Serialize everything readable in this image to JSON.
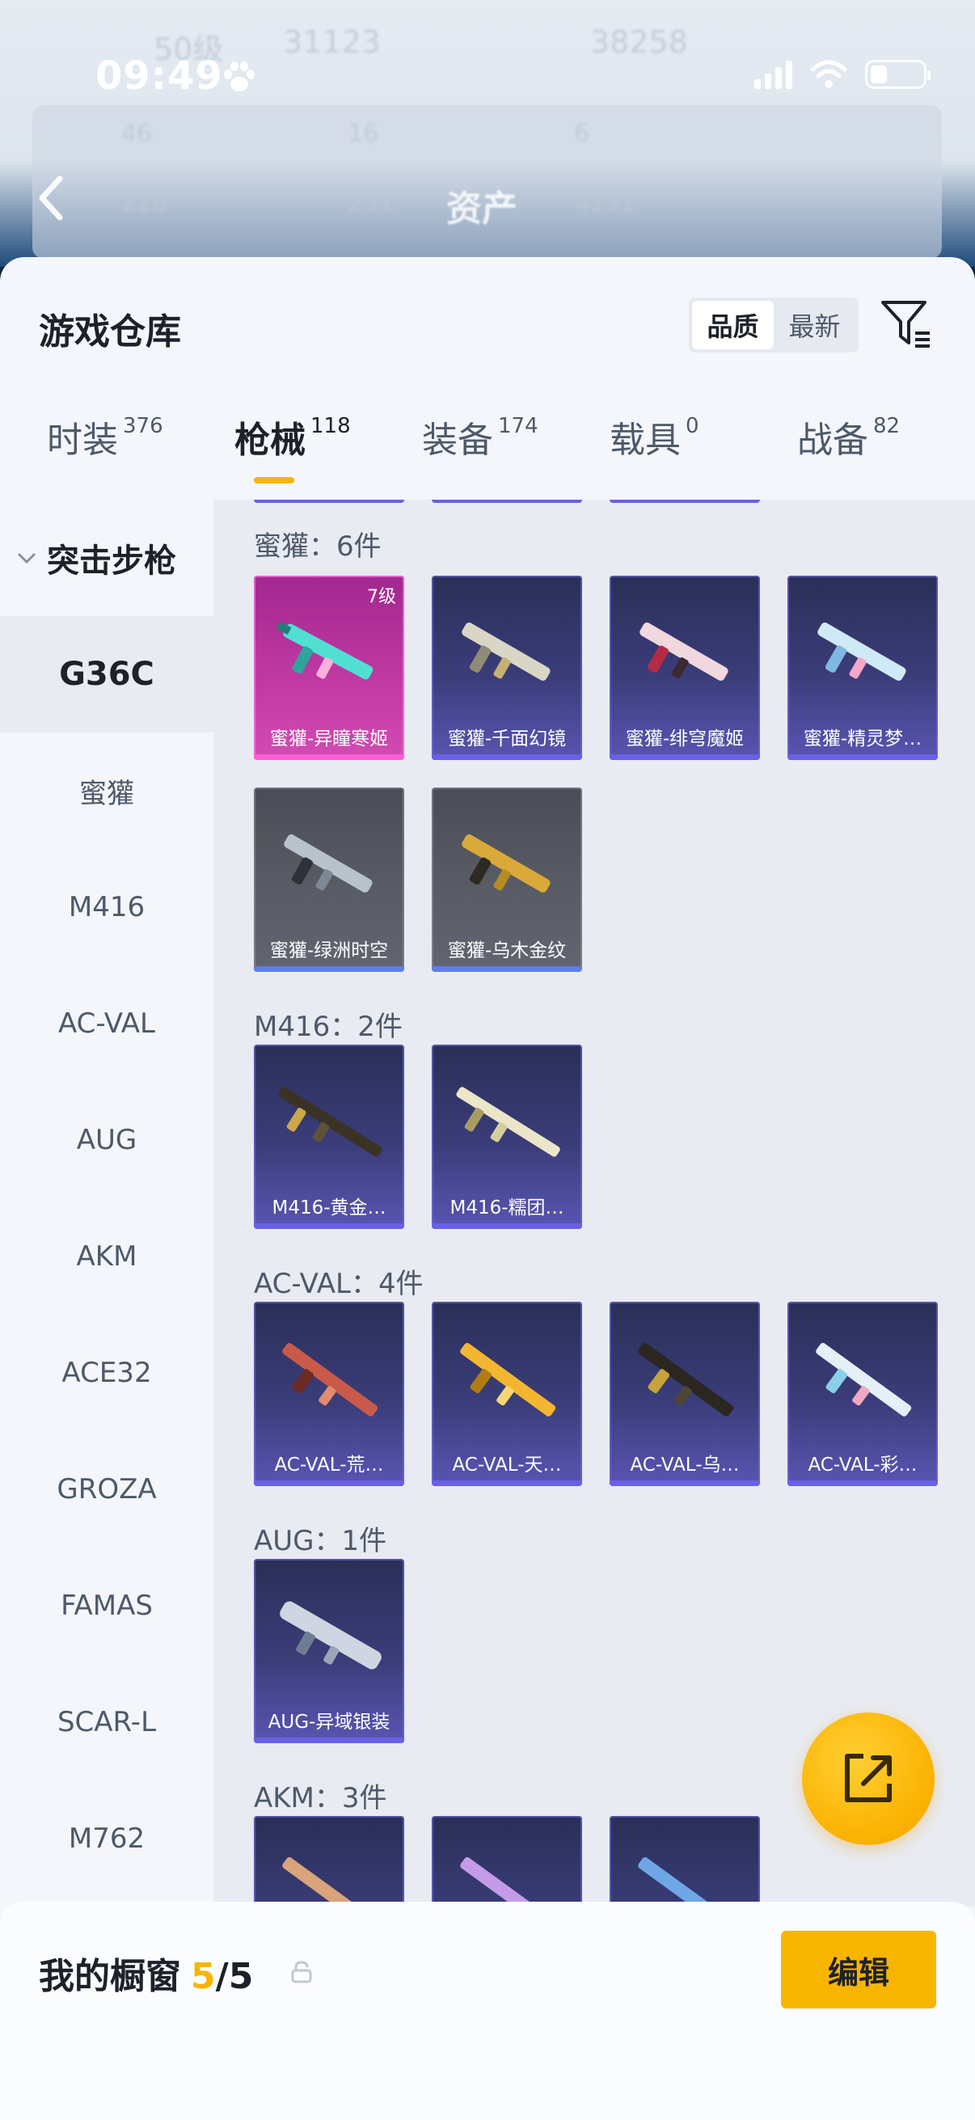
{
  "status_bar": {
    "time": "09:49"
  },
  "background": {
    "ghost_level": "50级",
    "ghost_count_a": "31123",
    "ghost_count_b": "38258",
    "ghost_stats_row1": [
      "46",
      "16",
      "6"
    ],
    "ghost_stats_row2": [
      "228",
      "231",
      "4131"
    ],
    "title": "资产"
  },
  "sheet": {
    "title": "游戏仓库",
    "sort_options": [
      "品质",
      "最新"
    ],
    "sort_selected": "品质"
  },
  "tabs": [
    {
      "label": "时装",
      "count": "376"
    },
    {
      "label": "枪械",
      "count": "118"
    },
    {
      "label": "装备",
      "count": "174"
    },
    {
      "label": "载具",
      "count": "0"
    },
    {
      "label": "战备",
      "count": "82"
    }
  ],
  "active_tab": "枪械",
  "sidebar": {
    "group": "突击步枪",
    "items": [
      "G36C",
      "蜜獾",
      "M416",
      "AC-VAL",
      "AUG",
      "AKM",
      "ACE32",
      "GROZA",
      "FAMAS",
      "SCAR-L",
      "M762"
    ],
    "active": "G36C"
  },
  "sections": [
    {
      "title": "蜜獾：6件",
      "items": [
        {
          "label": "蜜獾-异瞳寒姬",
          "level": "7级",
          "style": "pink"
        },
        {
          "label": "蜜獾-千面幻镜",
          "style": "purple"
        },
        {
          "label": "蜜獾-绯穹魔姬",
          "style": "purple"
        },
        {
          "label": "蜜獾-精灵梦…",
          "style": "purple"
        },
        {
          "label": "蜜獾-绿洲时空",
          "style": "gray"
        },
        {
          "label": "蜜獾-乌木金纹",
          "style": "gray"
        }
      ]
    },
    {
      "title": "M416：2件",
      "items": [
        {
          "label": "M416-黄金…",
          "style": "purple"
        },
        {
          "label": "M416-糯团…",
          "style": "purple"
        }
      ]
    },
    {
      "title": "AC-VAL：4件",
      "items": [
        {
          "label": "AC-VAL-荒…",
          "style": "purple"
        },
        {
          "label": "AC-VAL-天…",
          "style": "purple"
        },
        {
          "label": "AC-VAL-乌…",
          "style": "purple"
        },
        {
          "label": "AC-VAL-彩…",
          "style": "purple"
        }
      ]
    },
    {
      "title": "AUG：1件",
      "items": [
        {
          "label": "AUG-异域银装",
          "style": "purple"
        }
      ]
    },
    {
      "title": "AKM：3件",
      "items": [
        {
          "label": "",
          "style": "purple"
        },
        {
          "label": "",
          "style": "purple"
        },
        {
          "label": "",
          "style": "purple"
        }
      ]
    }
  ],
  "showcase": {
    "title": "我的橱窗",
    "current": "5",
    "separator": "/",
    "max": "5",
    "edit_label": "编辑"
  },
  "colors": {
    "accent": "#F7B500",
    "card_purple": "#3B3D7A",
    "card_pink": "#C23AA4",
    "card_gray": "#5A5D66"
  }
}
